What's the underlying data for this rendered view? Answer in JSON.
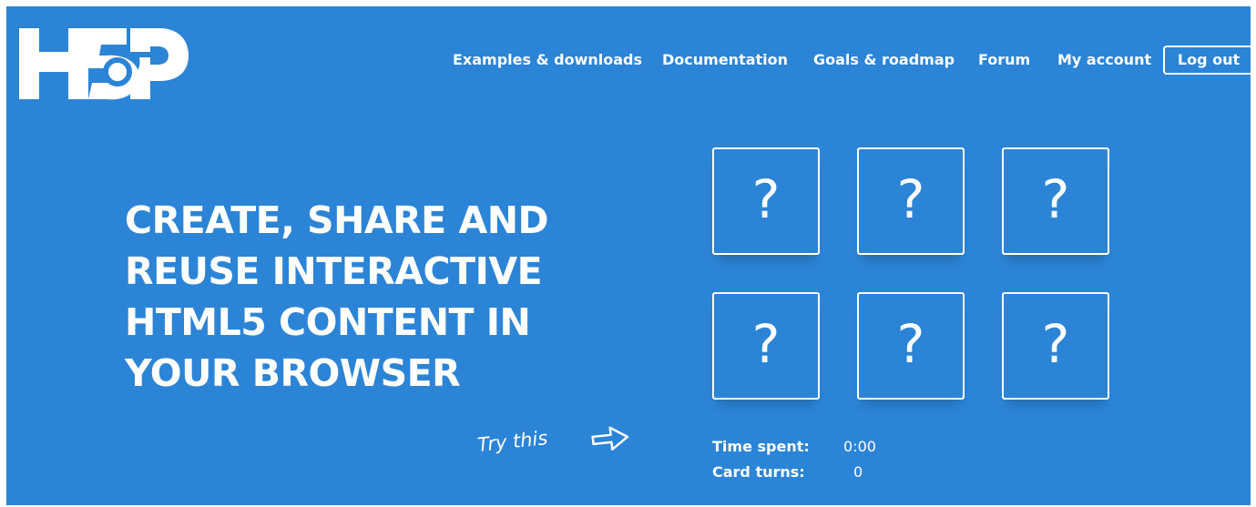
{
  "brand": {
    "logo_text": "H5P",
    "background_color": "#2c84d6",
    "foreground_color": "#ffffff"
  },
  "nav": {
    "items": [
      {
        "label": "Examples & downloads"
      },
      {
        "label": "Documentation"
      },
      {
        "label": "Goals & roadmap"
      },
      {
        "label": "Forum"
      },
      {
        "label": "My account"
      }
    ],
    "logout_label": "Log out"
  },
  "hero": {
    "headline_lines": [
      "CREATE, SHARE AND",
      "REUSE INTERACTIVE",
      "HTML5 CONTENT IN",
      "YOUR BROWSER"
    ],
    "try_this": "Try this"
  },
  "memory_game": {
    "cards": [
      {
        "face": "?"
      },
      {
        "face": "?"
      },
      {
        "face": "?"
      },
      {
        "face": "?"
      },
      {
        "face": "?"
      },
      {
        "face": "?"
      }
    ],
    "time_spent_label": "Time spent:",
    "time_spent_value": "0:00",
    "card_turns_label": "Card turns:",
    "card_turns_value": "0"
  }
}
